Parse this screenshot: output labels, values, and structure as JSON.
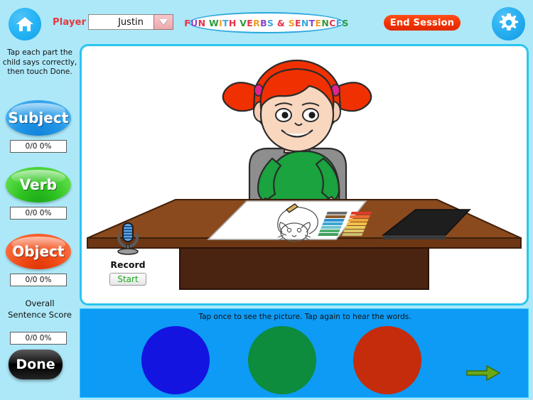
{
  "app": {
    "background_color": "#ade8f8",
    "panel_color": "#ffffff",
    "bottom_panel_color": "#0d9bf5",
    "border_color": "#2bc4f0"
  },
  "header": {
    "home_icon": "home-icon",
    "player_label": "Player",
    "player_value": "Justin",
    "player_placeholder": "Justin",
    "player_options": [
      "Justin"
    ],
    "dropdown_icon": "chevron-down-icon",
    "title_parts": [
      {
        "text": "F",
        "color": "#e8334a"
      },
      {
        "text": "U",
        "color": "#8e44c7"
      },
      {
        "text": "N",
        "color": "#e8334a"
      },
      {
        "text": " ",
        "color": "#000000"
      },
      {
        "text": "W",
        "color": "#2f9b3c"
      },
      {
        "text": "I",
        "color": "#f0a020"
      },
      {
        "text": "T",
        "color": "#3aa7e0"
      },
      {
        "text": "H",
        "color": "#e8334a"
      },
      {
        "text": " ",
        "color": "#000000"
      },
      {
        "text": "V",
        "color": "#2f9b3c"
      },
      {
        "text": "E",
        "color": "#e8334a"
      },
      {
        "text": "R",
        "color": "#f0a020"
      },
      {
        "text": "B",
        "color": "#8e44c7"
      },
      {
        "text": "S",
        "color": "#3aa7e0"
      },
      {
        "text": " ",
        "color": "#000000"
      },
      {
        "text": "&",
        "color": "#e8334a"
      },
      {
        "text": " ",
        "color": "#000000"
      },
      {
        "text": "S",
        "color": "#f0a020"
      },
      {
        "text": "E",
        "color": "#e8334a"
      },
      {
        "text": "N",
        "color": "#3aa7e0"
      },
      {
        "text": "T",
        "color": "#8e44c7"
      },
      {
        "text": "E",
        "color": "#f0a020"
      },
      {
        "text": "N",
        "color": "#2f9b3c"
      },
      {
        "text": "C",
        "color": "#e8334a"
      },
      {
        "text": "E",
        "color": "#3aa7e0"
      },
      {
        "text": "S",
        "color": "#2f9b3c"
      }
    ],
    "title_plain": "FUN WITH VERBS & SENTENCES",
    "end_session_label": "End Session",
    "end_session_color": "#f03000",
    "gear_icon": "gear-icon"
  },
  "sidebar": {
    "instructions": "Tap each part the child says correctly, then touch Done.",
    "parts": [
      {
        "label": "Subject",
        "score": "0/0 0%",
        "color": "#2196e8"
      },
      {
        "label": "Verb",
        "score": "0/0 0%",
        "color": "#2fc322"
      },
      {
        "label": "Object",
        "score": "0/0 0%",
        "color": "#f04b16"
      }
    ],
    "overall_label_line1": "Overall",
    "overall_label_line2": "Sentence Score",
    "overall_score": "0/0 0%",
    "done_label": "Done"
  },
  "stage": {
    "record": {
      "icon": "microphone-icon",
      "label": "Record",
      "start_label": "Start",
      "start_color": "#1aa81a"
    },
    "illustration": {
      "name": "girl-drawing-at-desk",
      "description": "Cartoon girl with red pigtails in a green shirt sitting at a brown desk drawing a cat on white paper, with a box of colored pastels beside her."
    }
  },
  "bottom": {
    "hint": "Tap once to see the picture. Tap again to hear the words.",
    "choices": [
      {
        "name": "choice-blue",
        "color": "#1414e0"
      },
      {
        "name": "choice-green",
        "color": "#0c8c3c"
      },
      {
        "name": "choice-red",
        "color": "#c42c0c"
      }
    ],
    "next_icon": "next-arrow-icon",
    "next_color": "#6aa818"
  }
}
